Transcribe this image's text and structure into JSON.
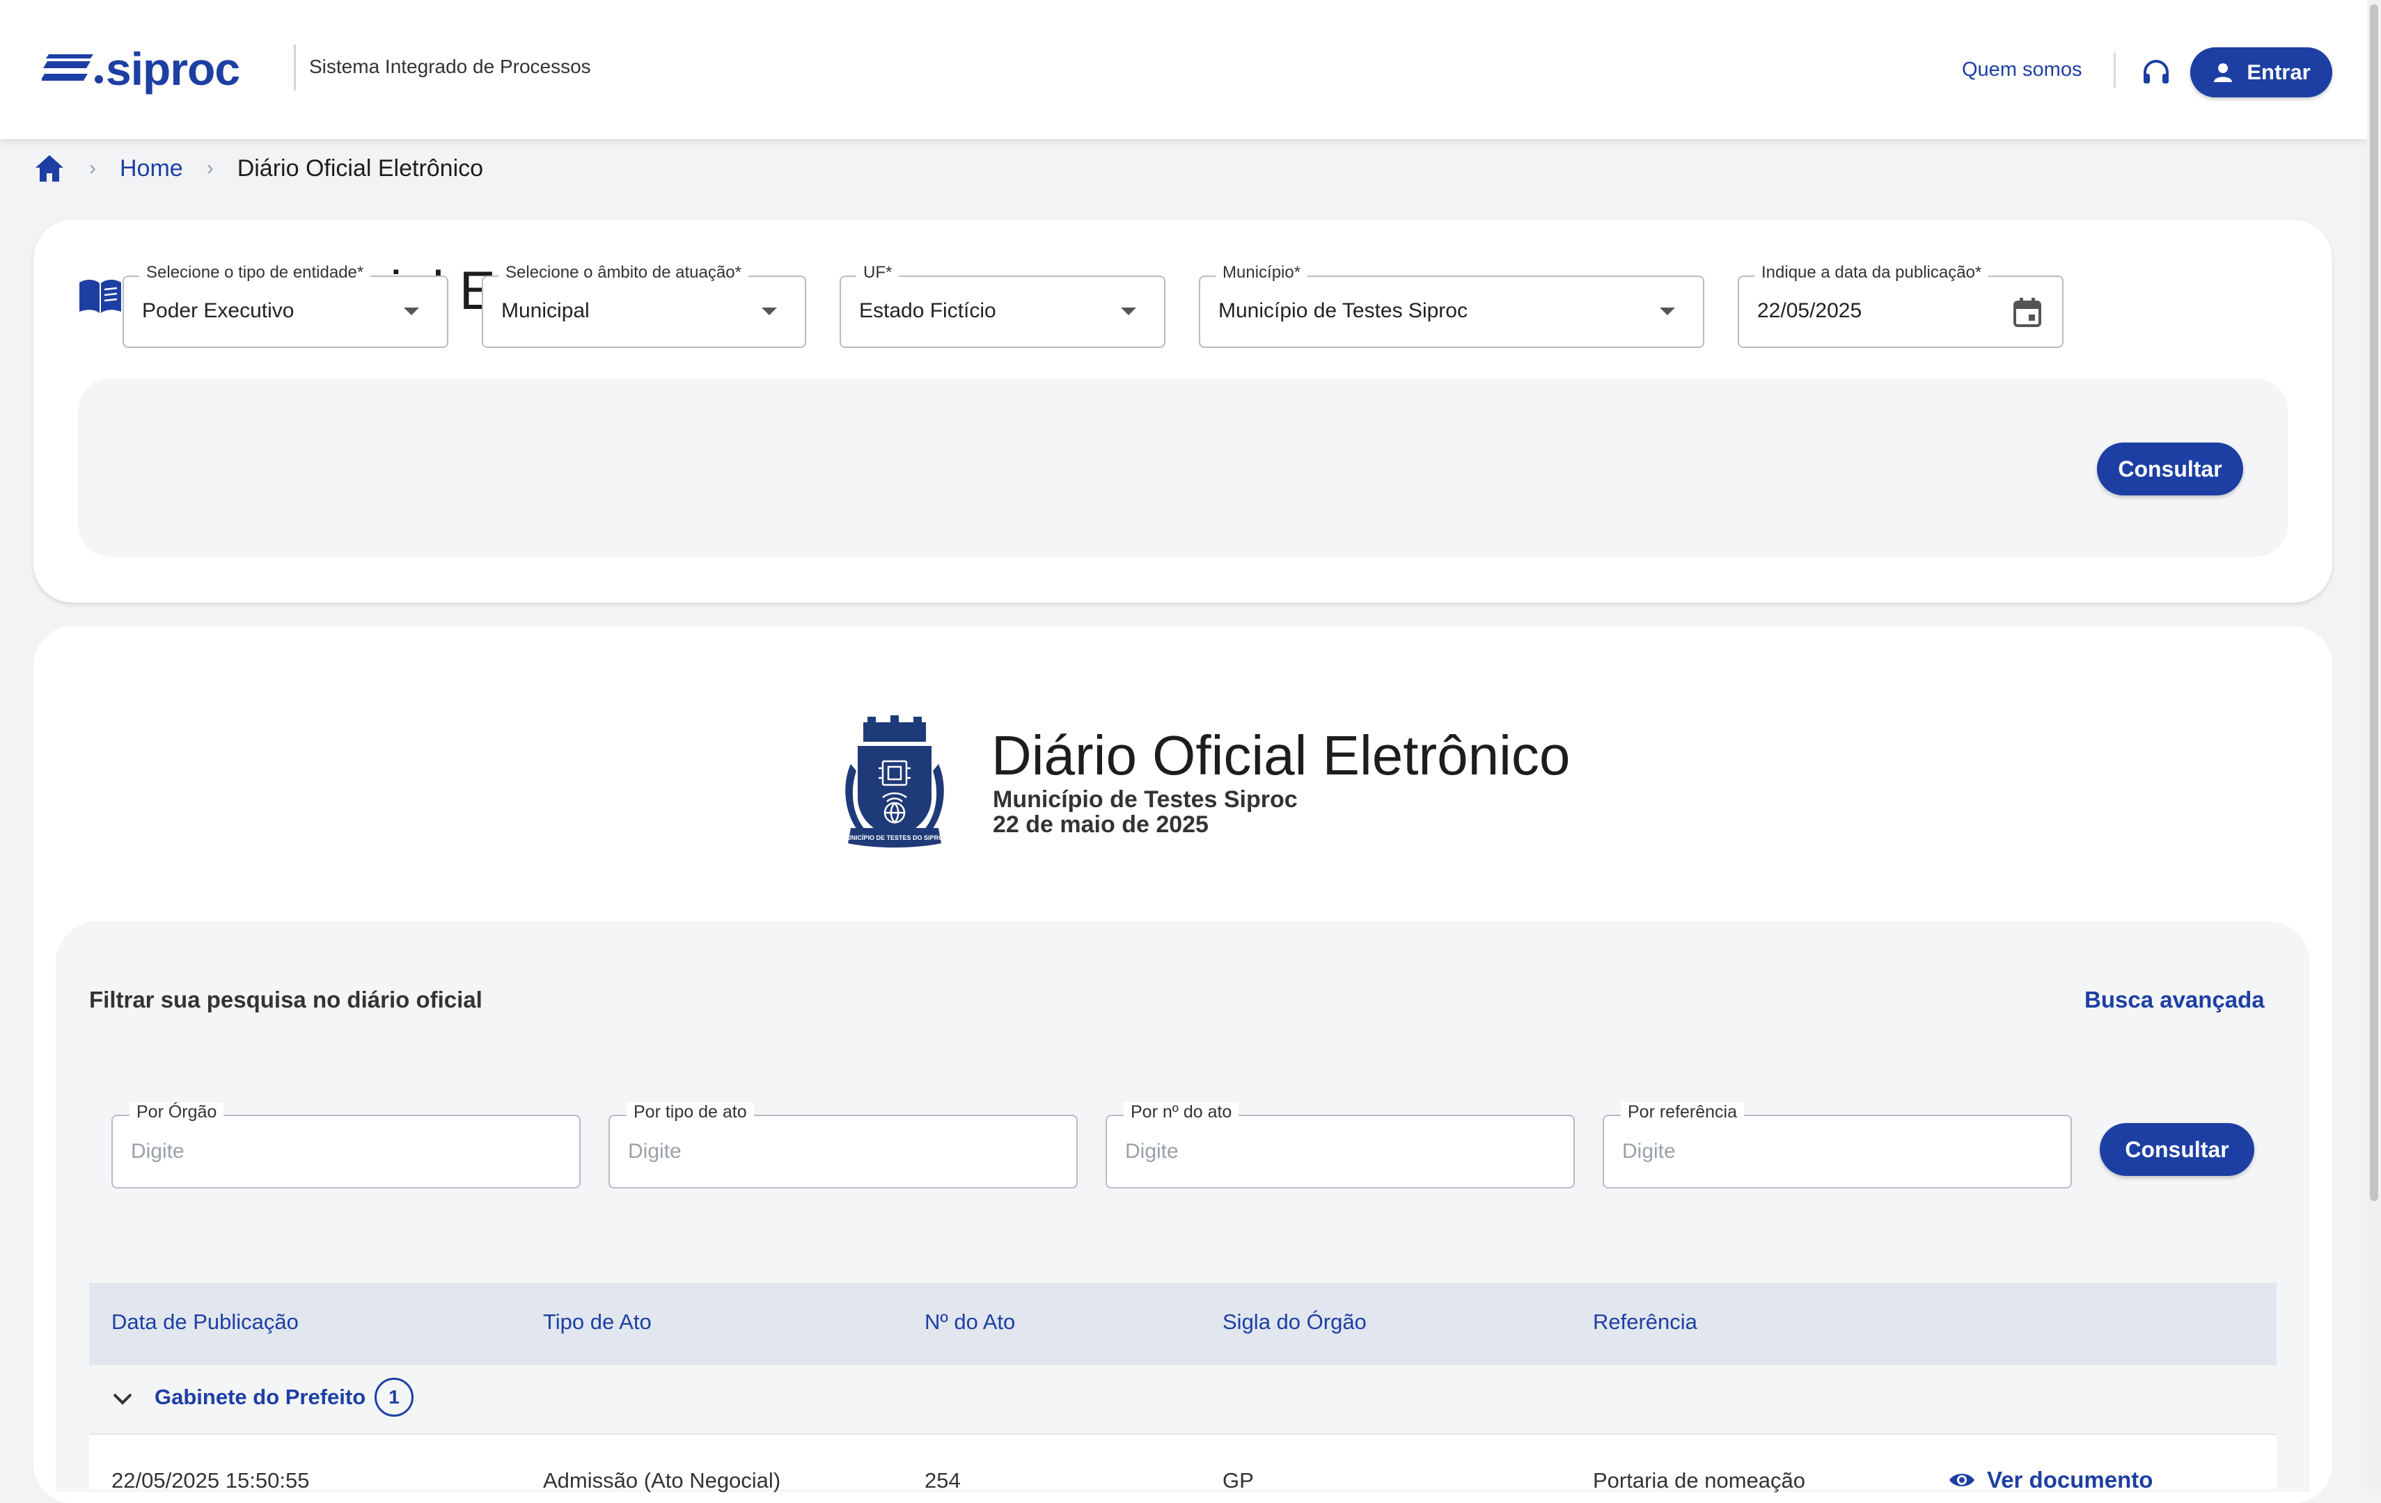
{
  "header": {
    "logo_text": "siproc",
    "tagline": "Sistema Integrado de Processos",
    "about_link": "Quem somos",
    "login_button": "Entrar",
    "brand_color": "#1d3fa3"
  },
  "breadcrumb": {
    "home": "Home",
    "current": "Diário Oficial Eletrônico"
  },
  "search": {
    "title": "Diário Oficial Eletrônico",
    "fields": {
      "entity": {
        "label": "Selecione o tipo de entidade*",
        "value": "Poder Executivo"
      },
      "scope": {
        "label": "Selecione o âmbito de atuação*",
        "value": "Municipal"
      },
      "uf": {
        "label": "UF*",
        "value": "Estado Fictício"
      },
      "municipality": {
        "label": "Município*",
        "value": "Município de Testes Siproc"
      },
      "date": {
        "label": "Indique a data da publicação*",
        "value": "22/05/2025"
      }
    },
    "submit": "Consultar"
  },
  "diario": {
    "title": "Diário Oficial Eletrônico",
    "municipality": "Município de Testes Siproc",
    "date": "22 de maio de 2025",
    "crest_text": "MUNICÍPIO DE TESTES DO SIPROC"
  },
  "filter": {
    "heading": "Filtrar sua pesquisa no diário oficial",
    "advanced_link": "Busca avançada",
    "fields": {
      "organ": {
        "label": "Por Órgão",
        "placeholder": "Digite"
      },
      "act_type": {
        "label": "Por tipo de ato",
        "placeholder": "Digite"
      },
      "act_number": {
        "label": "Por nº do ato",
        "placeholder": "Digite"
      },
      "reference": {
        "label": "Por referência",
        "placeholder": "Digite"
      }
    },
    "submit": "Consultar"
  },
  "table": {
    "columns": [
      "Data de Publicação",
      "Tipo de Ato",
      "Nº do Ato",
      "Sigla do Órgão",
      "Referência"
    ],
    "groups": [
      {
        "name": "Gabinete do Prefeito",
        "count": "1",
        "rows": [
          {
            "date": "22/05/2025 15:50:55",
            "type": "Admissão (Ato Negocial)",
            "number": "254",
            "organ": "GP",
            "reference": "Portaria de nomeação",
            "action": "Ver documento"
          }
        ]
      }
    ]
  }
}
